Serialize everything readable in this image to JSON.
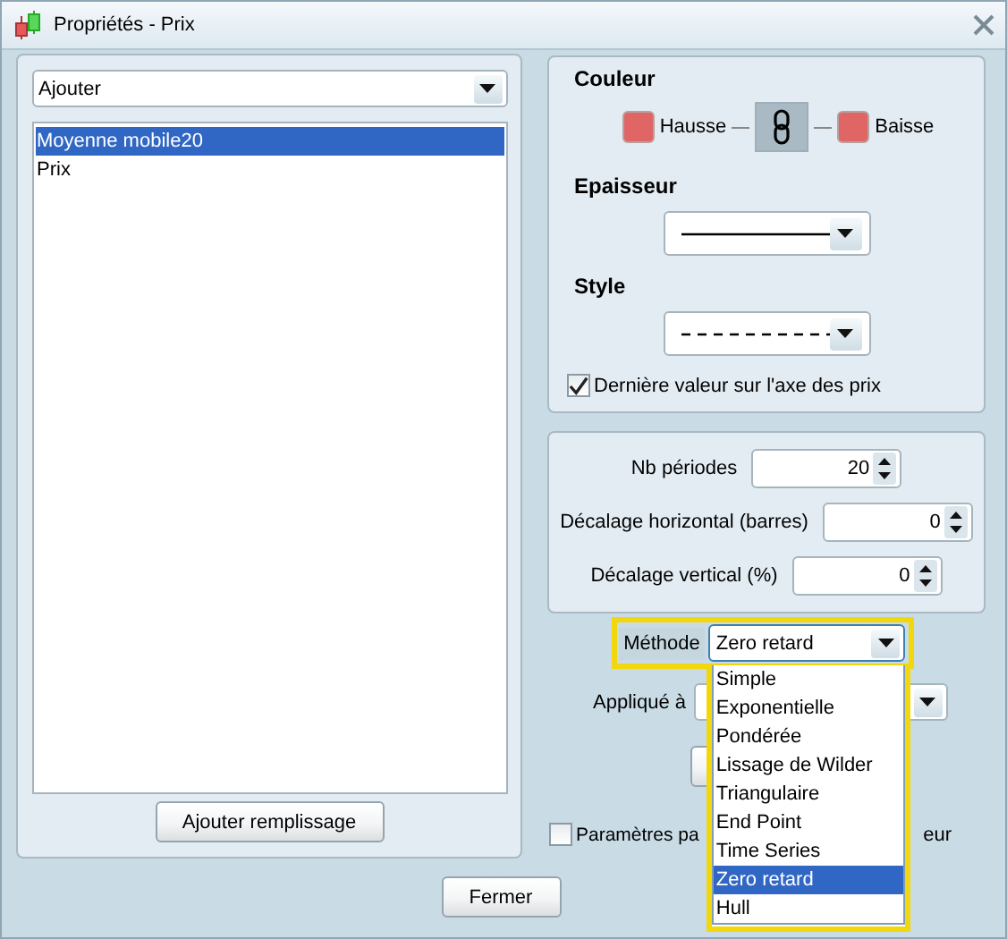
{
  "window": {
    "title": "Propriétés - Prix"
  },
  "left_panel": {
    "add_dropdown": {
      "value": "Ajouter"
    },
    "items": [
      {
        "label": "Moyenne mobile20",
        "selected": true
      },
      {
        "label": "Prix",
        "selected": false
      }
    ],
    "fill_button": {
      "label": "Ajouter remplissage"
    }
  },
  "color_section": {
    "title": "Couleur",
    "rise": {
      "label": "Hausse",
      "color": "#e06666"
    },
    "fall": {
      "label": "Baisse",
      "color": "#e06666"
    },
    "linked": true
  },
  "thickness_section": {
    "title": "Epaisseur",
    "dashed": false
  },
  "style_section": {
    "title": "Style",
    "dashed": true
  },
  "last_value_checkbox": {
    "label": "Dernière valeur sur l'axe des prix",
    "checked": true
  },
  "parameters": [
    {
      "label": "Nb périodes",
      "value": "20"
    },
    {
      "label": "Décalage horizontal (barres)",
      "value": "0"
    },
    {
      "label": "Décalage vertical (%)",
      "value": "0"
    }
  ],
  "method": {
    "label": "Méthode",
    "value": "Zero retard",
    "expanded": true,
    "options": [
      {
        "label": "Simple",
        "selected": false
      },
      {
        "label": "Exponentielle",
        "selected": false
      },
      {
        "label": "Pondérée",
        "selected": false
      },
      {
        "label": "Lissage de Wilder",
        "selected": false
      },
      {
        "label": "Triangulaire",
        "selected": false
      },
      {
        "label": "End Point",
        "selected": false
      },
      {
        "label": "Time Series",
        "selected": false
      },
      {
        "label": "Zero retard",
        "selected": true
      },
      {
        "label": "Hull",
        "selected": false
      }
    ]
  },
  "applied_to": {
    "label": "Appliqué à"
  },
  "params_checkbox": {
    "label_start": "Paramètres pa",
    "label_end": "eur",
    "checked": false
  },
  "close_button": {
    "label": "Fermer"
  }
}
